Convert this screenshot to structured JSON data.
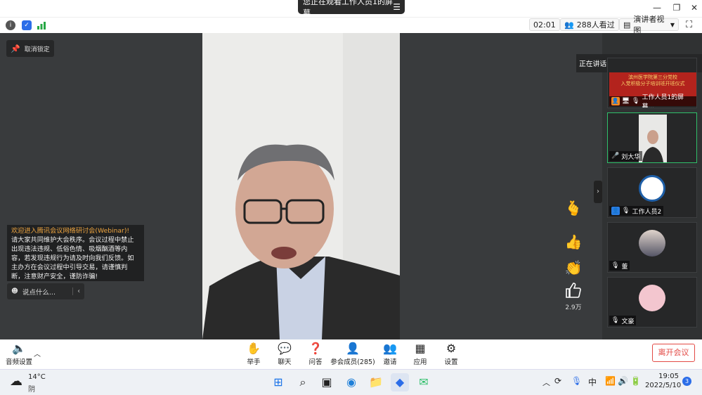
{
  "window": {
    "share_banner": "您正在观看工作人员1的屏幕",
    "minimize": "—",
    "restore": "❐",
    "close": "✕"
  },
  "toolbar": {
    "timer": "02:01",
    "viewers": "288人看过",
    "view_mode": "演讲者视图"
  },
  "stage": {
    "unlock_label": "取消锁定",
    "notice_head": "欢迎进入腾讯会议网络研讨会(Webinar)!",
    "notice_body": "请大家共同维护大会秩序。会议过程中禁止出现违法违规、低俗色情、吸烟酗酒等内容，若发现违规行为请及时向我们反馈。如主办方在会议过程中引导交易，请谨慎判断，注意财产安全，谨防诈骗!",
    "chat_placeholder": "说点什么...",
    "like_count": "2.9万"
  },
  "speaking": "正在讲话: 刘大华;",
  "participants": [
    {
      "name": "工作人员1的屏幕...",
      "banner_line1": "滨州医学院第三分党校",
      "banner_line2": "入党积极分子培训班开班仪式"
    },
    {
      "name": "刘大华"
    },
    {
      "name": "工作人员2"
    },
    {
      "name": "董"
    },
    {
      "name": "文豪"
    }
  ],
  "bottom": {
    "audio": "音频设置",
    "items": [
      "举手",
      "聊天",
      "问答",
      "参会成员(285)",
      "邀请",
      "应用",
      "设置"
    ],
    "leave": "离开会议"
  },
  "taskbar": {
    "temp": "14°C",
    "weather": "阴",
    "ime": "中",
    "time": "19:05",
    "date": "2022/5/10",
    "notif": "3"
  },
  "colors": {
    "accent": "#2b6de8",
    "leave": "#e34a45",
    "notice_head": "#f0a640"
  }
}
